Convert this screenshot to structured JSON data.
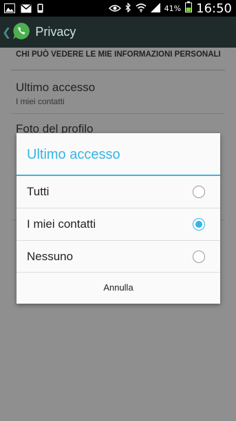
{
  "status_bar": {
    "battery_percent": "41%",
    "time": "16:50",
    "icons": [
      "picture-icon",
      "mail-icon",
      "phone-icon",
      "eye-icon",
      "bluetooth-icon",
      "wifi-icon",
      "signal-icon",
      "battery-icon"
    ]
  },
  "action_bar": {
    "title": "Privacy",
    "back_glyph": "❮"
  },
  "screen": {
    "section_header": "CHI PUÒ VEDERE LE MIE INFORMAZIONI PERSONALI",
    "items": [
      {
        "title": "Ultimo accesso",
        "summary": "I miei contatti"
      },
      {
        "title": "Foto del profilo"
      }
    ]
  },
  "dialog": {
    "title": "Ultimo accesso",
    "options": [
      {
        "label": "Tutti",
        "checked": false
      },
      {
        "label": "I miei contatti",
        "checked": true
      },
      {
        "label": "Nessuno",
        "checked": false
      }
    ],
    "cancel_label": "Annulla"
  },
  "colors": {
    "accent": "#33b5e5",
    "action_bar_bg": "#1f2a2a",
    "scrim_bg": "#8f8f8f"
  }
}
